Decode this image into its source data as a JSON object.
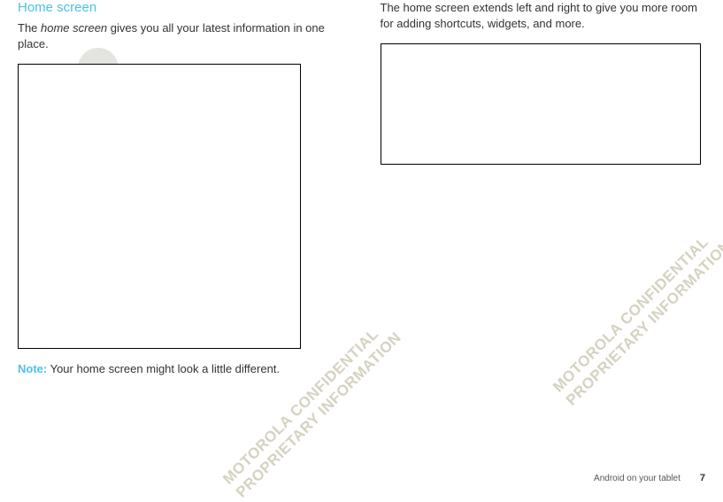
{
  "left": {
    "heading": "Home screen",
    "intro_pre": "The ",
    "intro_italic": "home screen",
    "intro_post": " gives you all your latest information in one place.",
    "note_label": "Note:",
    "note_text": " Your home screen might look a little different."
  },
  "right": {
    "intro": "The home screen extends left and right to give you more room for adding shortcuts, widgets, and more."
  },
  "watermark": {
    "line1": "MOTOROLA CONFIDENTIAL",
    "line2": "PROPRIETARY INFORMATION"
  },
  "footer": {
    "section": "Android on your tablet",
    "page": "7"
  }
}
